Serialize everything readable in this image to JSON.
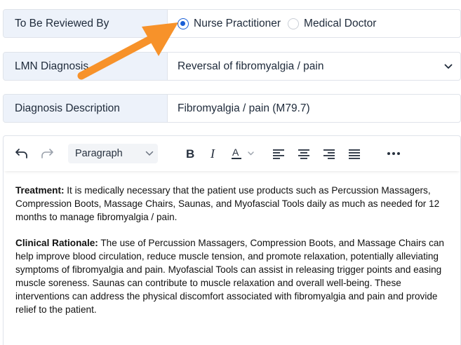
{
  "review": {
    "label": "To Be Reviewed By",
    "options": [
      {
        "label": "Nurse Practitioner",
        "selected": true
      },
      {
        "label": "Medical Doctor",
        "selected": false
      }
    ]
  },
  "diagnosis": {
    "label": "LMN Diagnosis",
    "value": "Reversal of fibromyalgia / pain"
  },
  "description": {
    "label": "Diagnosis Description",
    "value": "Fibromyalgia / pain (M79.7)"
  },
  "editor": {
    "block_format": "Paragraph",
    "toolbar_icons": [
      "undo-icon",
      "redo-icon",
      "bold-icon",
      "italic-icon",
      "text-color-icon",
      "align-left-icon",
      "align-center-icon",
      "align-right-icon",
      "justify-icon",
      "more-icon"
    ],
    "paragraphs": [
      {
        "heading": "Treatment:",
        "text": " It is medically necessary that the patient use products such as Percussion Massagers, Compression Boots, Massage Chairs, Saunas, and Myofascial Tools daily as much as needed for 12 months to manage fibromyalgia / pain."
      },
      {
        "heading": "Clinical Rationale:",
        "text": " The use of Percussion Massagers, Compression Boots, and Massage Chairs can help improve blood circulation, reduce muscle tension, and promote relaxation, potentially alleviating symptoms of fibromyalgia and pain. Myofascial Tools can assist in releasing trigger points and easing muscle soreness. Saunas can contribute to muscle relaxation and overall well-being. These interventions can address the physical discomfort associated with fibromyalgia and pain and provide relief to the patient."
      }
    ]
  },
  "colors": {
    "accent": "#1a5fd6",
    "arrow": "#f7922a",
    "label_bg": "#edf2fa"
  }
}
